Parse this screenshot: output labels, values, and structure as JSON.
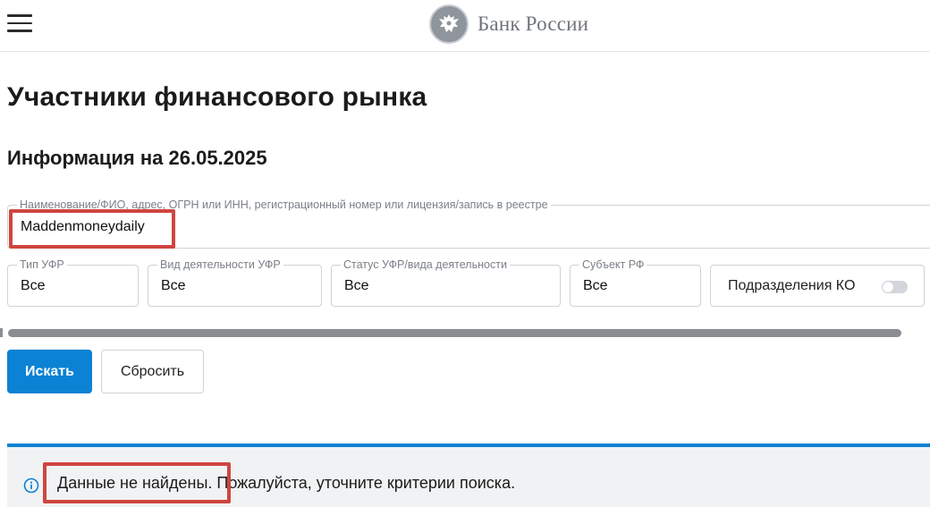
{
  "header": {
    "logo_text": "Банк России"
  },
  "page": {
    "title": "Участники финансового рынка",
    "info_date": "Информация на 26.05.2025"
  },
  "search": {
    "legend": "Наименование/ФИО, адрес, ОГРН или ИНН, регистрационный номер или лицензия/запись в реестре",
    "value": "Maddenmoneydaily"
  },
  "filters": {
    "type": {
      "legend": "Тип УФР",
      "value": "Все"
    },
    "kind": {
      "legend": "Вид деятельности УФР",
      "value": "Все"
    },
    "status": {
      "legend": "Статус УФР/вида деятельности",
      "value": "Все"
    },
    "region": {
      "legend": "Субъект РФ",
      "value": "Все"
    },
    "branches": {
      "label": "Подразделения КО",
      "enabled": false
    }
  },
  "buttons": {
    "search_label": "Искать",
    "reset_label": "Сбросить"
  },
  "notice": {
    "text": "Данные не найдены. Пожалуйста, уточните критерии поиска."
  },
  "colors": {
    "accent": "#0b82d4",
    "highlight": "#d0453f",
    "notice_bg": "#f1f2f4"
  },
  "icons": {
    "menu": "hamburger-menu-icon",
    "logo": "bank-of-russia-emblem-icon",
    "notice": "info-circle-icon"
  }
}
